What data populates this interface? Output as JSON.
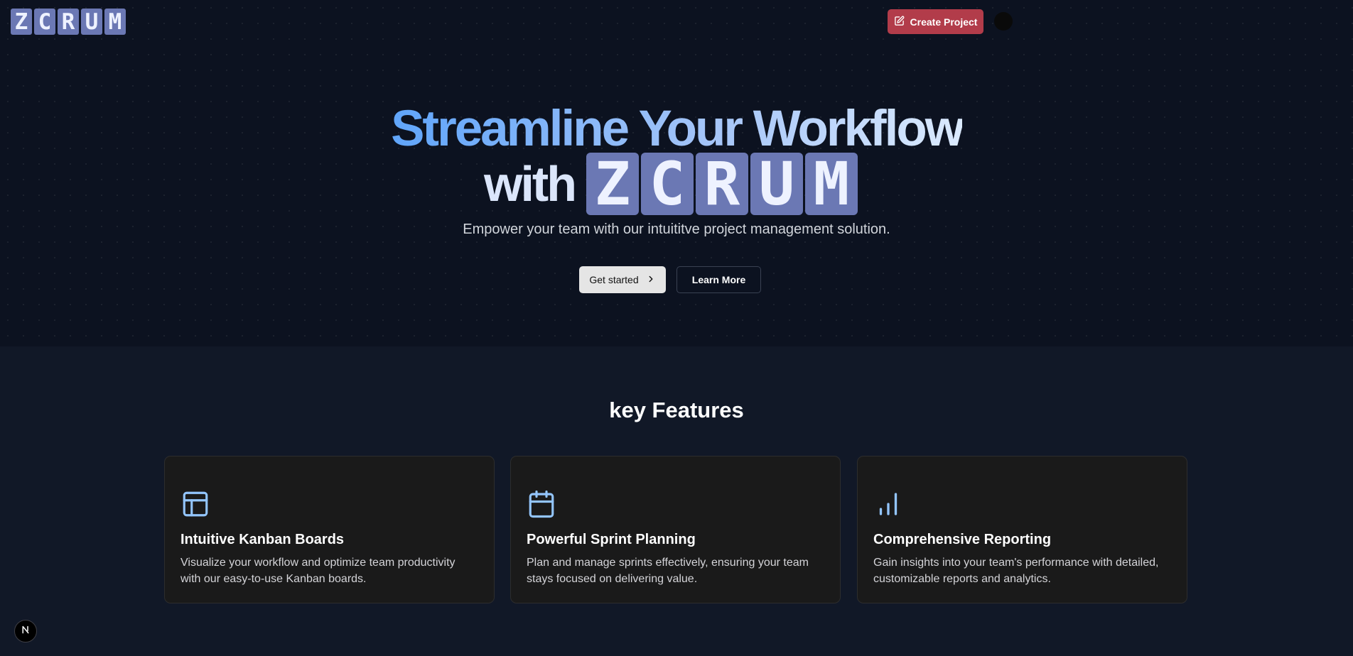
{
  "header": {
    "logo_letters": [
      "Z",
      "C",
      "R",
      "U",
      "M"
    ],
    "create_project_label": "Create Project",
    "create_icon": "edit-icon"
  },
  "hero": {
    "headline_line1": "Streamline Your Workflow",
    "headline_with": "with",
    "logo_letters": [
      "Z",
      "C",
      "R",
      "U",
      "M"
    ],
    "subtitle": "Empower your team with our intuititve project management solution.",
    "get_started_label": "Get started",
    "learn_more_label": "Learn More"
  },
  "features": {
    "title": "key Features",
    "items": [
      {
        "icon": "layout-icon",
        "title": "Intuitive Kanban Boards",
        "description": "Visualize your workflow and optimize team productivity with our easy-to-use Kanban boards."
      },
      {
        "icon": "calendar-icon",
        "title": "Powerful Sprint Planning",
        "description": "Plan and manage sprints effectively, ensuring your team stays focused on delivering value."
      },
      {
        "icon": "bar-chart-icon",
        "title": "Comprehensive Reporting",
        "description": "Gain insights into your team's performance with detailed, customizable reports and analytics."
      }
    ]
  },
  "colors": {
    "background": "#111827",
    "hero_background": "#0c1220",
    "logo_tile": "#6b78b4",
    "create_button": "#b23c4a",
    "icon_accent": "#93c5fd",
    "card_background": "#1a1a1a"
  }
}
